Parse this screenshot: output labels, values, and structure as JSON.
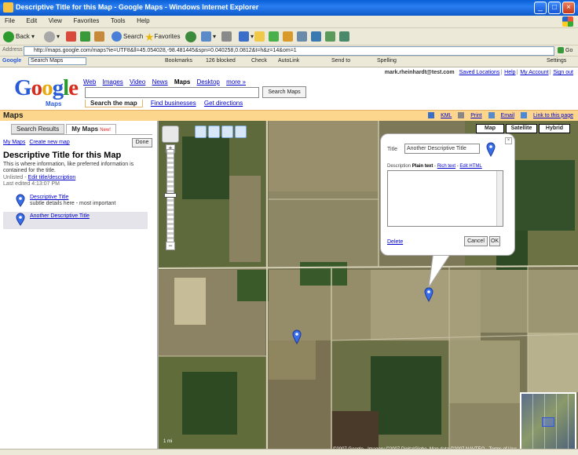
{
  "window": {
    "title": "Descriptive Title for this Map - Google Maps - Windows Internet Explorer"
  },
  "menu": [
    "File",
    "Edit",
    "View",
    "Favorites",
    "Tools",
    "Help"
  ],
  "nav": {
    "back": "Back",
    "search": "Search",
    "favorites": "Favorites"
  },
  "address": {
    "label": "Address",
    "url": "http://maps.google.com/maps?ie=UTF8&ll=45.054028,-98.481445&spn=0.040258,0.0812&t=h&z=14&om=1",
    "go": "Go"
  },
  "toolbar2": {
    "search_field": "Search Maps",
    "bookmarks": "Bookmarks",
    "blocked": "126 blocked",
    "check": "Check",
    "autolink": "AutoLink",
    "send_to": "Send to",
    "spelling": "Spelling",
    "settings": "Settings"
  },
  "google": {
    "logo_letters": [
      "G",
      "o",
      "o",
      "g",
      "l",
      "e"
    ],
    "logo_sub": "Maps",
    "nav": [
      "Web",
      "Images",
      "Video",
      "News",
      "Maps",
      "Desktop",
      "more »"
    ],
    "search_button": "Search Maps",
    "subtabs": [
      "Search the map",
      "Find businesses",
      "Get directions"
    ]
  },
  "user": {
    "email": "mark.rheinhardt@test.com",
    "links": [
      "Saved Locations",
      "Help",
      "My Account",
      "Sign out"
    ]
  },
  "mapsbar": {
    "title": "Maps",
    "links": [
      "KML",
      "Print",
      "Email",
      "Link to this page"
    ]
  },
  "sidebar": {
    "tabs": [
      "Search Results",
      "My Maps"
    ],
    "new_badge": "New!",
    "mymaps_link": "My Maps",
    "create_link": "Create new map",
    "done": "Done",
    "map_title": "Descriptive Title for this Map",
    "map_desc": "This is where information, like preferred information is contained for the title.",
    "map_meta_prefix": "Unlisted -",
    "map_meta_link": "Edit title/description",
    "map_meta_updated": "Last edited 4:13:07 PM",
    "pins": [
      {
        "title": "Descriptive Title",
        "desc": "subtle details here - most important"
      },
      {
        "title": "Another Descriptive Title",
        "desc": ""
      }
    ]
  },
  "map": {
    "types": [
      "Map",
      "Satellite",
      "Hybrid"
    ],
    "scale": "1 mi",
    "copyright": "©2007 Google - Imagery ©2007 DigitalGlobe, Map data ©2007 NAVTEQ - Terms of Use"
  },
  "infowindow": {
    "title_label": "Title",
    "title_value": "Another Descriptive Title",
    "desc_label": "Description",
    "plain_text": "Plain text",
    "rich_text": "Rich text",
    "edit_html": "Edit HTML",
    "delete": "Delete",
    "cancel": "Cancel",
    "ok": "OK"
  }
}
